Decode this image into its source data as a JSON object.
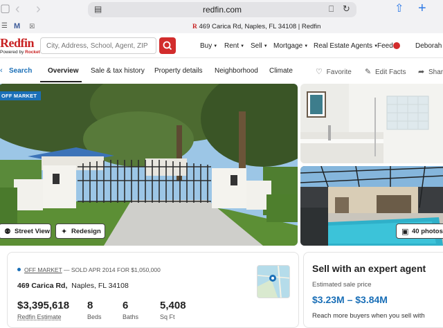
{
  "browser": {
    "url": "redfin.com",
    "tab_title": "469 Carica Rd, Naples, FL 34108 | Redfin",
    "tab_favicon": "R",
    "pinned_m": "M"
  },
  "header": {
    "logo": "Redfin",
    "logo_sub_prefix": "Powered by",
    "logo_sub_brand": "Rocket",
    "search_placeholder": "City, Address, School, Agent, ZIP",
    "nav": [
      "Buy",
      "Rent",
      "Sell",
      "Mortgage",
      "Real Estate Agents"
    ],
    "feed": "Feed",
    "user": "Deborah"
  },
  "subnav": {
    "search": "Search",
    "tabs": [
      "Overview",
      "Sale & tax history",
      "Property details",
      "Neighborhood",
      "Climate"
    ],
    "favorite": "Favorite",
    "edit_facts": "Edit Facts",
    "share": "Share"
  },
  "photos": {
    "badge": "OFF MARKET",
    "street_view": "Street View",
    "redesign": "Redesign",
    "count": "40 photos"
  },
  "listing": {
    "status_off": "OFF MARKET",
    "status_sold": "— SOLD APR 2014 FOR $1,050,000",
    "street": "469 Carica Rd,",
    "city": "Naples, FL 34108",
    "estimate": "$3,395,618",
    "estimate_label": "Redfin Estimate",
    "beds": "8",
    "beds_label": "Beds",
    "baths": "6",
    "baths_label": "Baths",
    "sqft": "5,408",
    "sqft_label": "Sq Ft"
  },
  "sell": {
    "heading": "Sell with an expert agent",
    "est_label": "Estimated sale price",
    "range": "$3.23M – $3.84M",
    "pitch": "Reach more buyers when you sell with"
  },
  "colors": {
    "brand_red": "#c82021",
    "link_blue": "#1a6fb7"
  }
}
